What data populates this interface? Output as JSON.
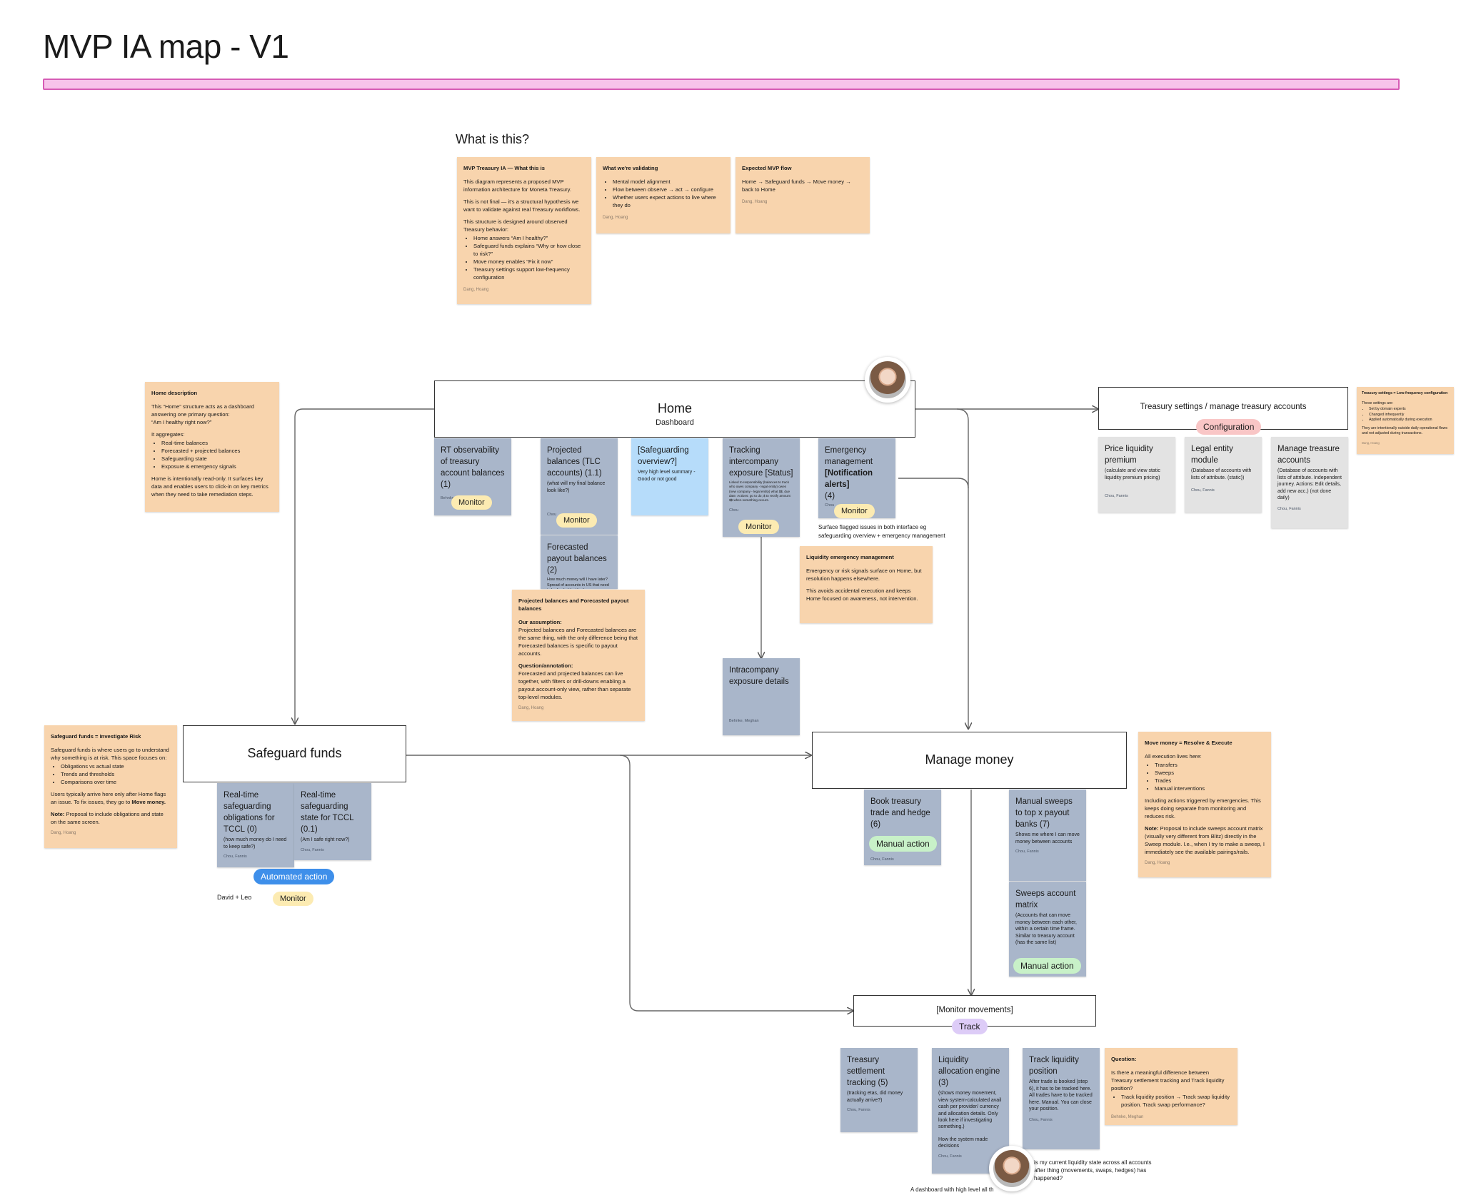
{
  "board": {
    "title": "MVP IA map - V1",
    "section_heading": "What is this?"
  },
  "intro_notes": {
    "what_this_is": {
      "title": "MVP Treasury IA — What this is",
      "p1": "This diagram represents a proposed MVP information architecture for Moneta Treasury.",
      "p2": "This is not final — it's a structural hypothesis we want to validate against real Treasury workflows.",
      "p3": "This structure is designed around observed Treasury behavior:",
      "items": [
        "Home answers “Am I healthy?”",
        "Safeguard funds explains “Why or how close to risk?”",
        "Move money enables “Fix it now”",
        "Treasury settings support low-frequency configuration"
      ],
      "author": "Dang, Hoang"
    },
    "validating": {
      "title": "What we're validating",
      "items": [
        "Mental model alignment",
        "Flow between observe → act → configure",
        "Whether users expect actions to live where they do"
      ],
      "author": "Dang, Hoang"
    },
    "flow": {
      "title": "Expected MVP flow",
      "text": "Home → Safeguard funds → Move money → back to Home",
      "author": "Dang, Hoang"
    }
  },
  "home_description": {
    "title": "Home description",
    "p1": "This “Home” structure acts as a dashboard answering one primary question:",
    "p2": "“Am I healthy right now?”",
    "p3": "It aggregates:",
    "items": [
      "Real-time balances",
      "Forecasted + projected balances",
      "Safeguarding state",
      "Exposure & emergency signals"
    ],
    "p4": "Home is intentionally read-only. It surfaces key data and enables users to click-in on key metrics when they need to take remediation steps."
  },
  "home": {
    "title": "Home",
    "subtitle": "Dashboard",
    "cards": {
      "rt": {
        "title": "RT observability of treasury account balances (1)",
        "author": "Behnke",
        "pill": "Monitor"
      },
      "projected": {
        "title": "Projected balances (TLC accounts) (1.1)",
        "sub": "(what will my final balance look like?)",
        "author": "Chou",
        "pill": "Monitor"
      },
      "forecast": {
        "title": "Forecasted payout balances (2)",
        "sub": "How much money will I have later? Spread of accounts in US that need to be funded (netting)"
      },
      "safeguarding": {
        "title": "[Safeguarding overview?]",
        "sub": "Very high level summary - Good or not good"
      },
      "tracking": {
        "title": "Tracking intercompany exposure [Status]",
        "sub": "Linked to responsibility (balances to track who owes company - legal entity) owes (new company - legal entity) what $$, due date. Actions: go to do; $ to rectify amount $$ when something occurs.",
        "author": "Chou",
        "pill": "Monitor"
      },
      "emergency": {
        "title": "Emergency management",
        "title_bold": "[Notification alerts]",
        "num": "(4)",
        "author": "Chou",
        "pill": "Monitor"
      }
    },
    "flag_text": "Surface flagged issues in both interface eg safeguarding overview + emergency management"
  },
  "projected_note": {
    "title": "Projected balances and Forecasted payout balances",
    "assumption_label": "Our assumption:",
    "assumption": "Projected balances and Forecasted balances are the same thing, with the only difference being that Forecasted balances is specific to payout accounts.",
    "question_label": "Question/annotation:",
    "question": "Forecasted and projected balances can live together, with filters or drill-downs enabling a payout account-only view, rather than separate top-level modules.",
    "author": "Dang, Hoang"
  },
  "liquidity_note": {
    "title": "Liquidity emergency management",
    "p1": "Emergency or risk signals surface on Home, but resolution happens elsewhere.",
    "p2": "This avoids accidental execution and keeps Home focused on awareness, not intervention."
  },
  "intracompany": {
    "title": "Intracompany exposure details",
    "author": "Behnke, Meghan"
  },
  "settings": {
    "title": "Treasury settings / manage treasury accounts",
    "pill": "Configuration",
    "cards": [
      {
        "title": "Price liquidity premium",
        "sub": "(calculate and view static liquidity premium pricing)",
        "author": "Chou, Fannis"
      },
      {
        "title": "Legal entity module",
        "sub": "(Database of accounts with lists of attribute. (static))",
        "author": "Chou, Fannis"
      },
      {
        "title": "Manage treasure accounts",
        "sub": "(Database of accounts with lists of attribute. Independent journey. Actions: Edit details, add new acc.) (not done daily)",
        "author": "Chou, Fannis"
      }
    ],
    "note": {
      "title": "Treasury settings = Low-frequency configuration",
      "p1": "These settings are:",
      "items": [
        "Set by domain experts",
        "Changed infrequently",
        "Applied automatically during execution"
      ],
      "p2": "They are intentionally outside daily operational flows and not adjusted during transactions.",
      "author": "Dang, Hoang"
    }
  },
  "safeguard": {
    "title": "Safeguard funds",
    "cards": [
      {
        "title": "Real-time safeguarding obligations for TCCL (0)",
        "sub": "(how much money do I need to keep safe?)",
        "author": "Chou, Fannis"
      },
      {
        "title": "Real-time safeguarding state for TCCL (0.1)",
        "sub": "(Am I safe right now?)",
        "author": "Chou, Fannis"
      }
    ],
    "pill_auto": "Automated action",
    "pill_monitor": "Monitor",
    "people": "David + Leo",
    "note": {
      "title": "Safeguard funds = Investigate Risk",
      "p1": "Safeguard funds is where users go to understand why something is at risk. This space focuses on:",
      "items": [
        "Obligations vs actual state",
        "Trends and thresholds",
        "Comparisons over time"
      ],
      "p2a": "Users typically arrive here only after Home flags an issue. To fix issues, they go to ",
      "p2b": "Move money.",
      "p3a": "Note:",
      "p3b": " Proposal to include obligations and state on the same screen.",
      "author": "Dang, Hoang"
    }
  },
  "manage": {
    "title": "Manage money",
    "cards": {
      "book": {
        "title": "Book treasury trade and hedge (6)",
        "pill": "Manual action",
        "author": "Chou, Fannis"
      },
      "sweeps": {
        "title": "Manual sweeps to top x payout banks (7)",
        "sub": "Shows me where I can move money between accounts",
        "author": "Chou, Fannis"
      },
      "matrix": {
        "title": "Sweeps account matrix",
        "sub": "(Accounts that can move money between each other, within a certain time frame. Similar to treasury account (has the same list)",
        "pill": "Manual action"
      }
    },
    "note": {
      "title": "Move money = Resolve & Execute",
      "p1": "All execution lives here:",
      "items": [
        "Transfers",
        "Sweeps",
        "Trades",
        "Manual interventions"
      ],
      "p2": "Including actions triggered by emergencies. This keeps doing separate from monitoring and reduces risk.",
      "p3a": "Note:",
      "p3b": " Proposal to include sweeps account matrix (visually very different from Blitz) directly in the Sweep module. I.e., when I try to make a sweep, I immediately see the available pairings/rails.",
      "author": "Dang, Hoang"
    }
  },
  "monitor": {
    "title": "[Monitor movements]",
    "pill": "Track",
    "cards": [
      {
        "title": "Treasury settlement tracking (5)",
        "sub": "(tracking etas, did money actually arrive?)",
        "author": "Chou, Fannis"
      },
      {
        "title": "Liquidity allocation engine (3)",
        "sub": "(shows money movement, view system-calculated avail cash per provider/ currency and allocation details. Only look here if investigating something.)",
        "sub2": "How the system made decisions",
        "author": "Chou, Fannis"
      },
      {
        "title": "Track liquidity position",
        "sub": "After trade is booked (step 6), it has to be tracked here. All trades have to be tracked here. Manual. You can close your position.",
        "author": "Chou, Fannis"
      }
    ],
    "question_note": {
      "title": "Question:",
      "p1": "Is there a meaningful difference between Treasury settlement tracking and Track liquidity position?",
      "item": "Track liquidity position → Track swap liquidity position. Track swap performance?",
      "author": "Behnke, Meghan"
    },
    "comment1": "is my current liquidity state across all accounts after thing (movements, swaps, hedges) has happened?",
    "comment2": "A dashboard with high level all th"
  },
  "colors": {
    "note": "#f8d4ad",
    "card": "#a9b6ca",
    "settings_card": "#e3e3e3",
    "highlight_card": "#b6dcfa",
    "title_bar": "#f7c3ea",
    "title_bar_border": "#d65cb5"
  }
}
